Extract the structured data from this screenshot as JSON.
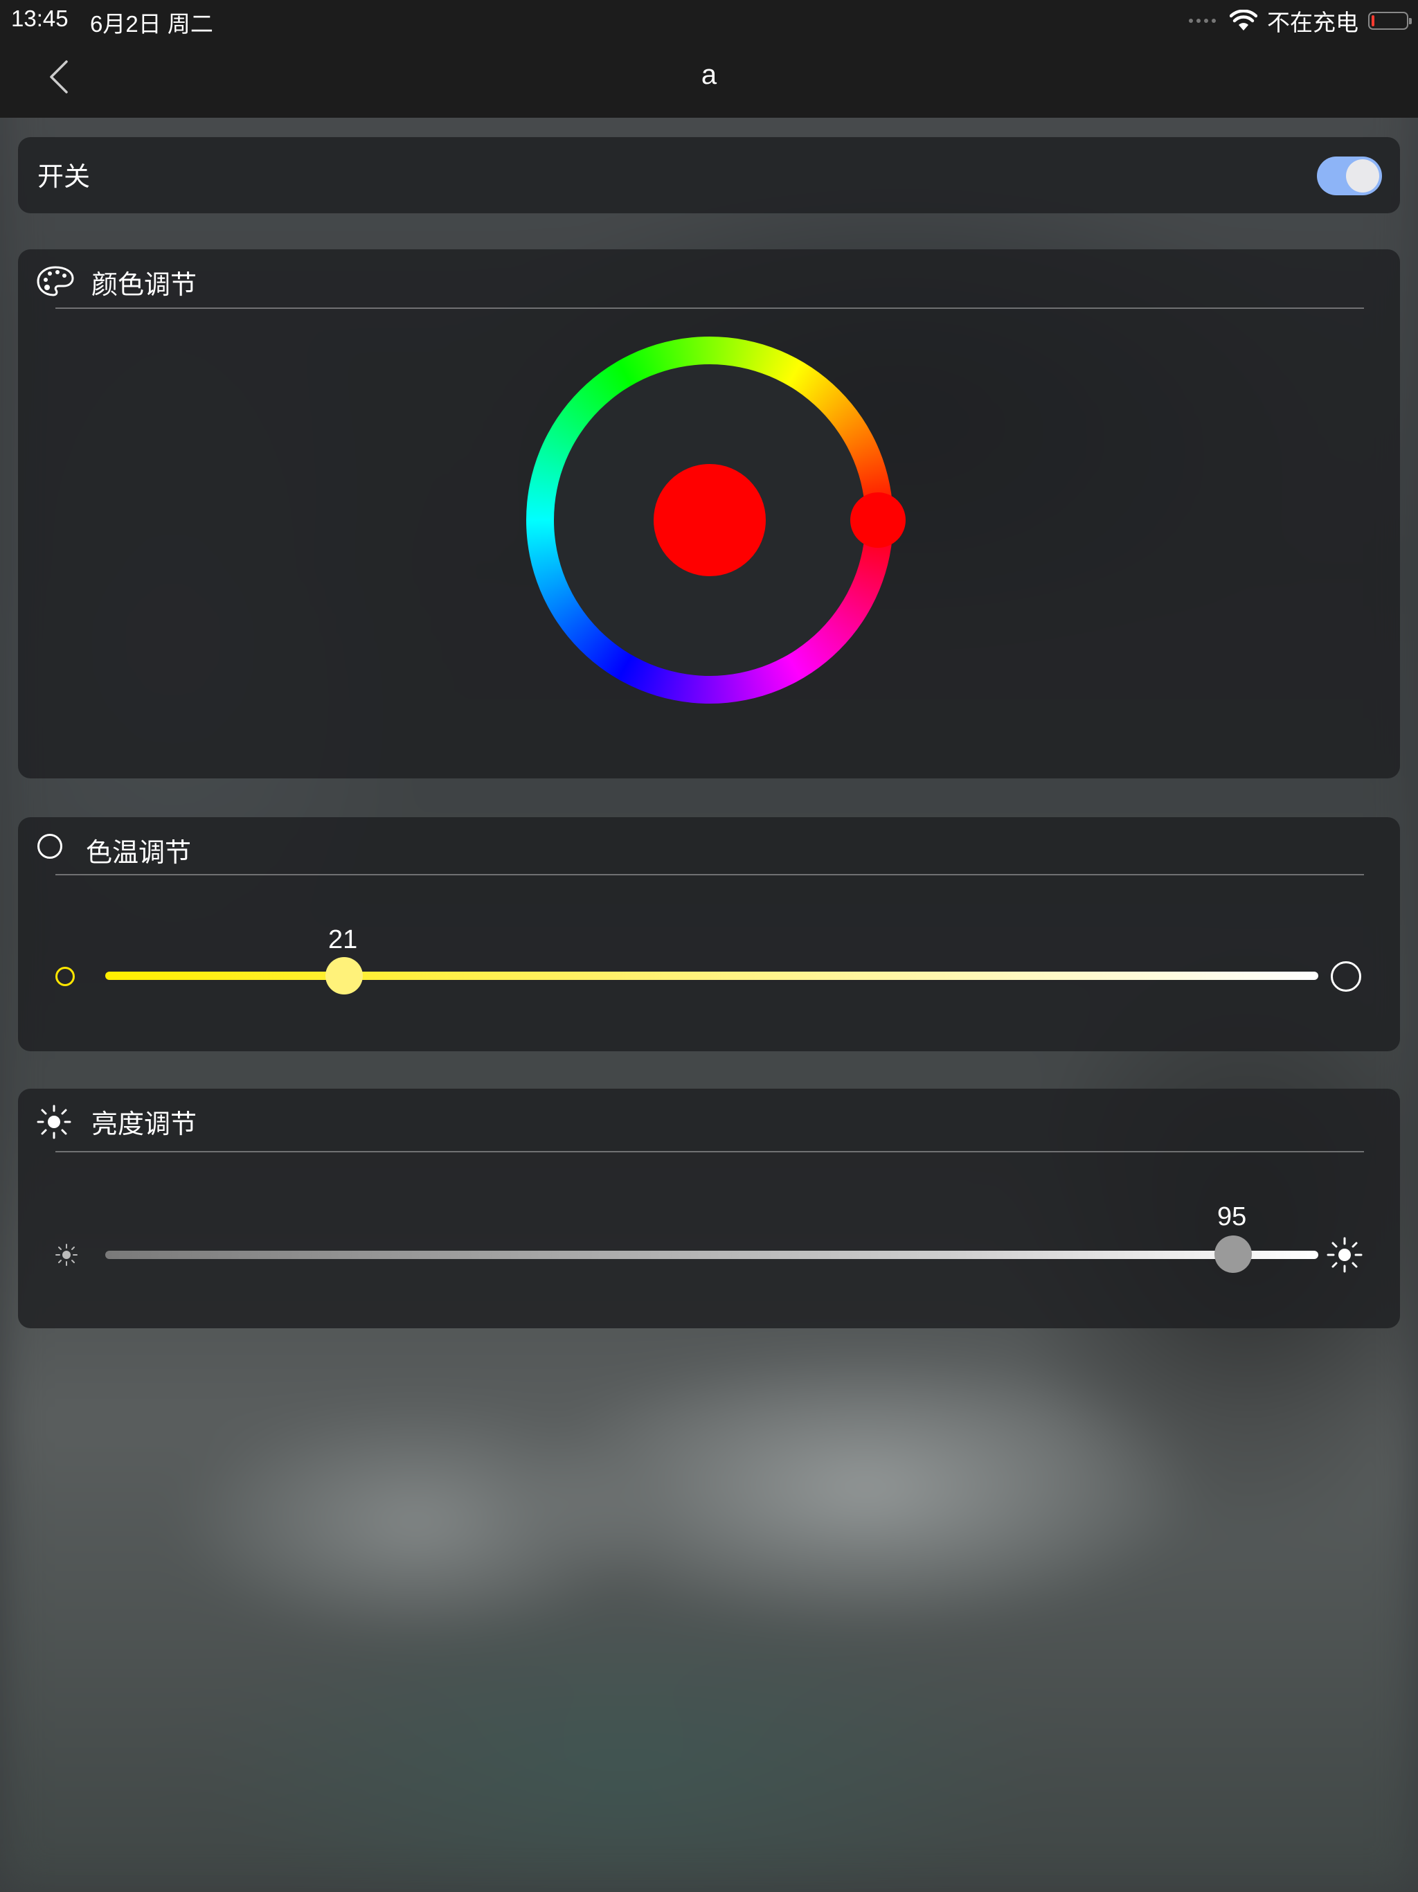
{
  "status_bar": {
    "time": "13:45",
    "date": "6月2日 周二",
    "charging": "不在充电"
  },
  "nav": {
    "title": "a"
  },
  "switch_card": {
    "label": "开关",
    "on": true,
    "accent_color": "#8db4f7"
  },
  "color_card": {
    "title": "颜色调节",
    "selected_color": "#ff0000",
    "hue_degrees": 0
  },
  "color_temp_card": {
    "title": "色温调节",
    "value": "21",
    "fraction": 0.21
  },
  "brightness_card": {
    "title": "亮度调节",
    "value": "95",
    "fraction": 0.95
  }
}
